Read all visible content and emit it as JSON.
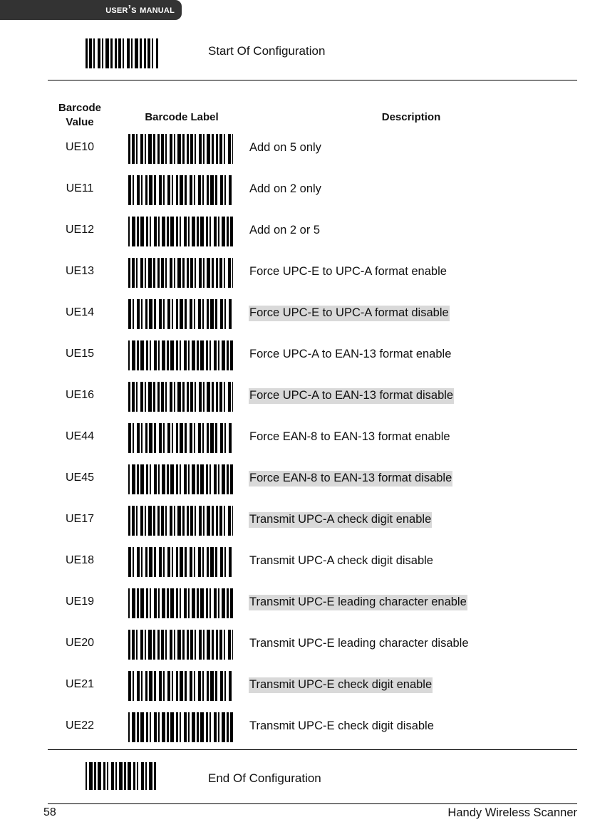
{
  "header": {
    "banner_title": "User’s Manual"
  },
  "start_config": {
    "label": "Start Of Configuration",
    "barcode_icon": "barcode-icon"
  },
  "table": {
    "headers": {
      "barcode_value": "Barcode Value",
      "barcode_label": "Barcode Label",
      "description": "Description"
    },
    "rows": [
      {
        "value": "UE10",
        "description": "Add on 5 only",
        "highlighted": false
      },
      {
        "value": "UE11",
        "description": "Add on 2 only",
        "highlighted": false
      },
      {
        "value": "UE12",
        "description": "Add on 2 or 5",
        "highlighted": false
      },
      {
        "value": "UE13",
        "description": "Force UPC-E to UPC-A format enable",
        "highlighted": false
      },
      {
        "value": "UE14",
        "description": "Force UPC-E to UPC-A format disable",
        "highlighted": true
      },
      {
        "value": "UE15",
        "description": "Force UPC-A to EAN-13 format enable",
        "highlighted": false
      },
      {
        "value": "UE16",
        "description": "Force UPC-A to EAN-13 format disable",
        "highlighted": true
      },
      {
        "value": "UE44",
        "description": "Force EAN-8 to EAN-13 format enable",
        "highlighted": false
      },
      {
        "value": "UE45",
        "description": "Force EAN-8 to EAN-13 format disable",
        "highlighted": true
      },
      {
        "value": "UE17",
        "description": "Transmit UPC-A check digit enable",
        "highlighted": true
      },
      {
        "value": "UE18",
        "description": "Transmit UPC-A check digit disable",
        "highlighted": false
      },
      {
        "value": "UE19",
        "description": "Transmit UPC-E leading character enable",
        "highlighted": true
      },
      {
        "value": "UE20",
        "description": "Transmit UPC-E leading character disable",
        "highlighted": false
      },
      {
        "value": "UE21",
        "description": "Transmit UPC-E check digit enable",
        "highlighted": true
      },
      {
        "value": "UE22",
        "description": "Transmit UPC-E check digit disable",
        "highlighted": false
      }
    ]
  },
  "end_config": {
    "label": "End Of Configuration",
    "barcode_icon": "barcode-icon"
  },
  "footer": {
    "page_number": "58",
    "product_name": "Handy Wireless Scanner"
  },
  "colors": {
    "banner_background": "#333333",
    "banner_text": "#ffffff",
    "highlight_background": "#d9d9d9",
    "rule": "#000000",
    "page_background": "#ffffff"
  }
}
